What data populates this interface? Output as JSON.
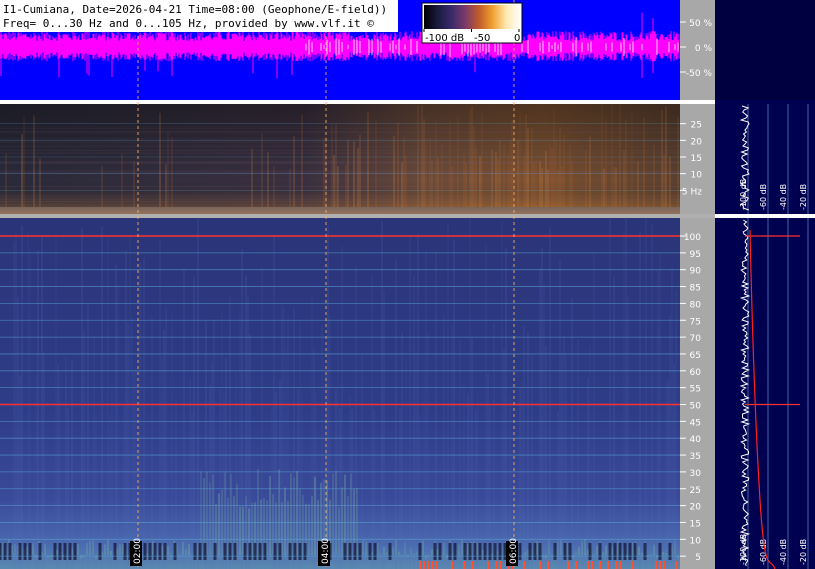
{
  "header": {
    "line1": "I1-Cumiana, Date=2026-04-21 Time=08:00 (Geophone/E-field))",
    "line2": "Freq= 0...30 Hz and 0...105 Hz, provided by www.vlf.it ©"
  },
  "colorbar": {
    "labels": [
      "-100 dB",
      "-50",
      "0"
    ],
    "stops": [
      "#000000",
      "#1a1a40",
      "#3a2a6a",
      "#7a3a6a",
      "#c05a2a",
      "#f0a030",
      "#ffe8b0",
      "#ffffff"
    ]
  },
  "colors": {
    "waveform_bg": "#0000ff",
    "waveform": "#ff00ff",
    "spectrum_bg": "#000050",
    "grid": "#5aa8d8",
    "mains_line": "#ff3030",
    "time_marker": "#ffb060",
    "axis_bg": "#a8a8a8"
  },
  "chart_data": [
    {
      "type": "line",
      "panel": "waveform",
      "ylabel_ticks": [
        "50 %",
        "0 %",
        "-50 %"
      ],
      "y_values": [
        50,
        0,
        -50
      ],
      "ylim": [
        -100,
        100
      ],
      "time_markers": [
        2,
        4,
        6
      ]
    },
    {
      "type": "heatmap",
      "panel": "spectrogram-low",
      "y_unit": "Hz",
      "ylim": [
        0,
        30
      ],
      "y_ticks": [
        25,
        20,
        15,
        10,
        5
      ],
      "y_tick_labels": [
        "25",
        "20",
        "15",
        "10",
        "5 Hz"
      ],
      "spectrum_ticks": [
        "-100 dB",
        "-60 dB",
        "-40 dB",
        "-20 dB"
      ]
    },
    {
      "type": "heatmap",
      "panel": "spectrogram-high",
      "ylim": [
        0,
        105
      ],
      "y_ticks": [
        100,
        95,
        90,
        85,
        80,
        75,
        70,
        65,
        60,
        55,
        50,
        45,
        40,
        35,
        30,
        25,
        20,
        15,
        10,
        5
      ],
      "mains_lines_hz": [
        50,
        100
      ],
      "time_labels": [
        "02:00",
        "04:00",
        "06:00"
      ],
      "time_positions_h": [
        2,
        4,
        6
      ],
      "spectrum_ticks": [
        "-100 dB",
        "-60 dB",
        "-40 dB",
        "-20 dB"
      ]
    }
  ]
}
